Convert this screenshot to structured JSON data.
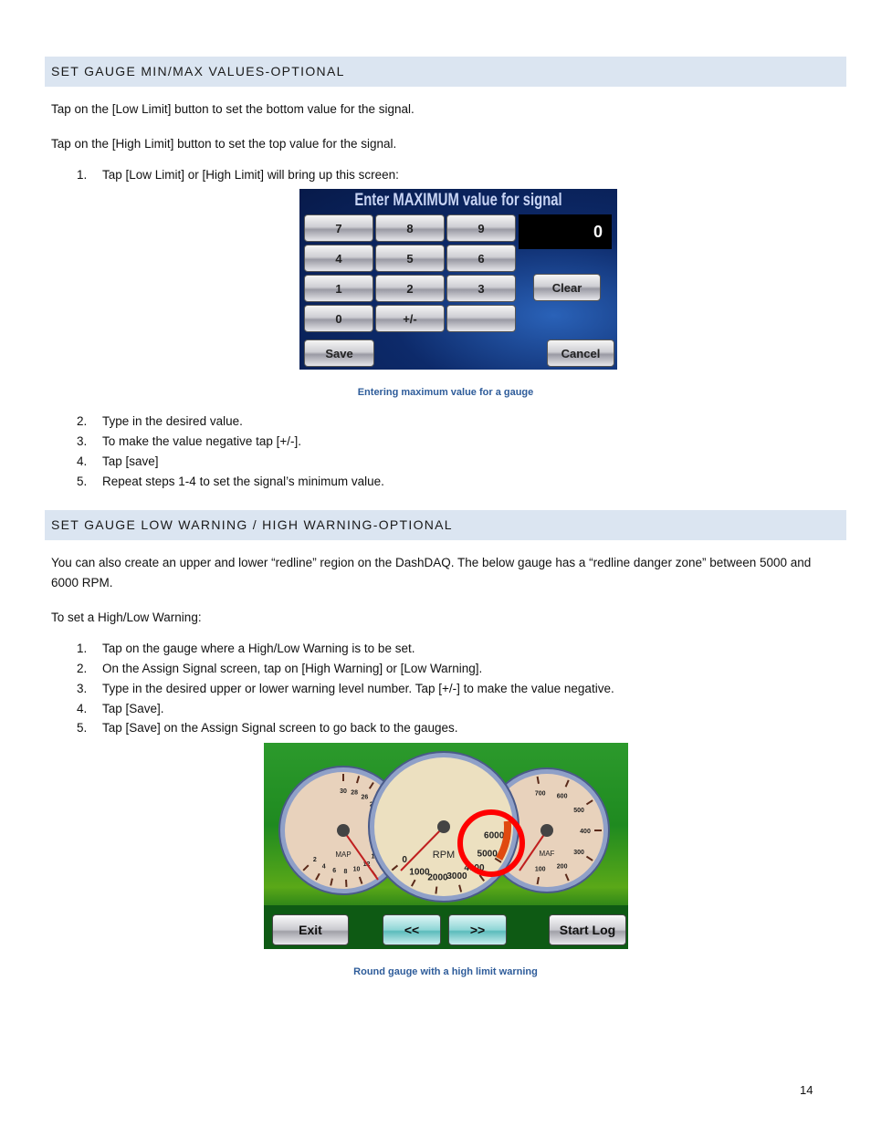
{
  "section1": {
    "heading": "SET GAUGE MIN/MAX VALUES-OPTIONAL",
    "para1": "Tap on the [Low Limit] button to set the bottom value for the signal.",
    "para2": "Tap on the [High Limit] button to set the top value for the signal.",
    "steps": [
      {
        "n": "1.",
        "text": "Tap [Low Limit]  or [High Limit] will bring up this screen:"
      },
      {
        "n": "2.",
        "text": "Type in the desired value."
      },
      {
        "n": "3.",
        "text": "To make the value negative tap [+/-]."
      },
      {
        "n": "4.",
        "text": "Tap [save]"
      },
      {
        "n": "5.",
        "text": "Repeat steps 1-4 to set the signal’s minimum value."
      }
    ],
    "figure": {
      "title": "Enter MAXIMUM value for signal",
      "keys": [
        "7",
        "8",
        "9",
        "4",
        "5",
        "6",
        "1",
        "2",
        "3",
        "0",
        "+/-",
        ""
      ],
      "display_value": "0",
      "clear": "Clear",
      "save": "Save",
      "cancel": "Cancel"
    },
    "caption": "Entering maximum value for a gauge"
  },
  "section2": {
    "heading": "SET GAUGE LOW WARNING / HIGH WARNING-OPTIONAL",
    "para1": "You can also create an upper and lower “redline” region on the DashDAQ. The below gauge has a “redline danger zone” between 5000 and 6000 RPM.",
    "para2": "To set a High/Low Warning:",
    "steps": [
      {
        "n": "1.",
        "text": "Tap on the gauge where a High/Low Warning is to be set."
      },
      {
        "n": "2.",
        "text": "On the Assign Signal screen, tap on [High Warning] or [Low Warning]."
      },
      {
        "n": "3.",
        "text": "Type in the desired upper or lower warning level number. Tap [+/-] to make the value negative."
      },
      {
        "n": "4.",
        "text": "Tap [Save]."
      },
      {
        "n": "5.",
        "text": "Tap [Save] on the Assign Signal screen to go back to the gauges."
      }
    ],
    "figure": {
      "left_gauge": {
        "label": "MAP",
        "ticks": [
          "2",
          "4",
          "6",
          "8",
          "10",
          "12",
          "14",
          "16",
          "18",
          "20",
          "22",
          "24",
          "26",
          "28",
          "30"
        ]
      },
      "center_gauge": {
        "label": "RPM",
        "ticks": [
          "0",
          "1000",
          "2000",
          "3000",
          "4000",
          "5000",
          "6000"
        ]
      },
      "right_gauge": {
        "label": "MAF",
        "ticks": [
          "100",
          "200",
          "300",
          "400",
          "500",
          "600",
          "700"
        ]
      },
      "warning_highlight_color": "#ff0000",
      "exit": "Exit",
      "prev": "<<",
      "next": ">>",
      "start_log": "Start Log"
    },
    "caption": "Round gauge with a high limit warning"
  },
  "page_number": "14"
}
